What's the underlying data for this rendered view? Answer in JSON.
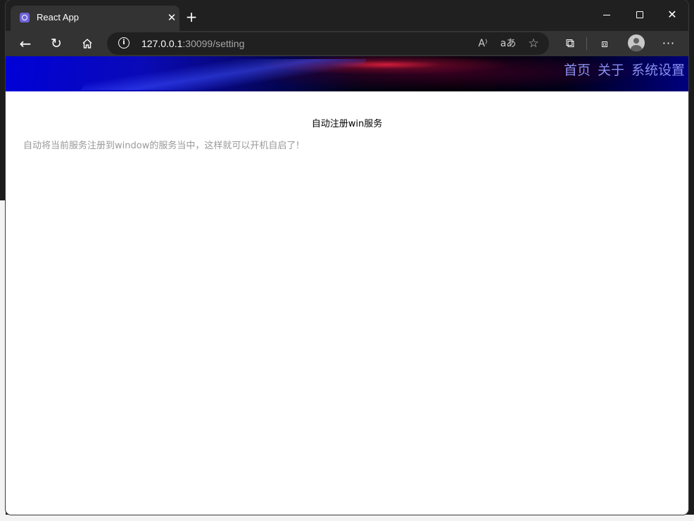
{
  "browser": {
    "tab": {
      "title": "React App",
      "favicon": "react-app-favicon-icon",
      "close_symbol": "✕"
    },
    "new_tab_symbol": "+",
    "window_controls": {
      "close_symbol": "✕"
    },
    "address": {
      "host": "127.0.0.1",
      "rest": ":30099/setting",
      "info_symbol": "i"
    },
    "icons": {
      "back": "←",
      "refresh": "↻",
      "read_aloud": "A⁾",
      "translate": "aあ",
      "favorite": "☆",
      "extensions": "⧉",
      "collections": "⧈",
      "more": "···"
    }
  },
  "site": {
    "nav": {
      "items": [
        "首页",
        "关于",
        "系统设置"
      ]
    },
    "colors": {
      "nav_link": "#8a8ff0",
      "header_left": "#0000d8",
      "header_accent": "#dc1e3c"
    }
  },
  "main": {
    "title": "自动注册win服务",
    "description": "自动将当前服务注册到window的服务当中，这样就可以开机自启了!"
  }
}
